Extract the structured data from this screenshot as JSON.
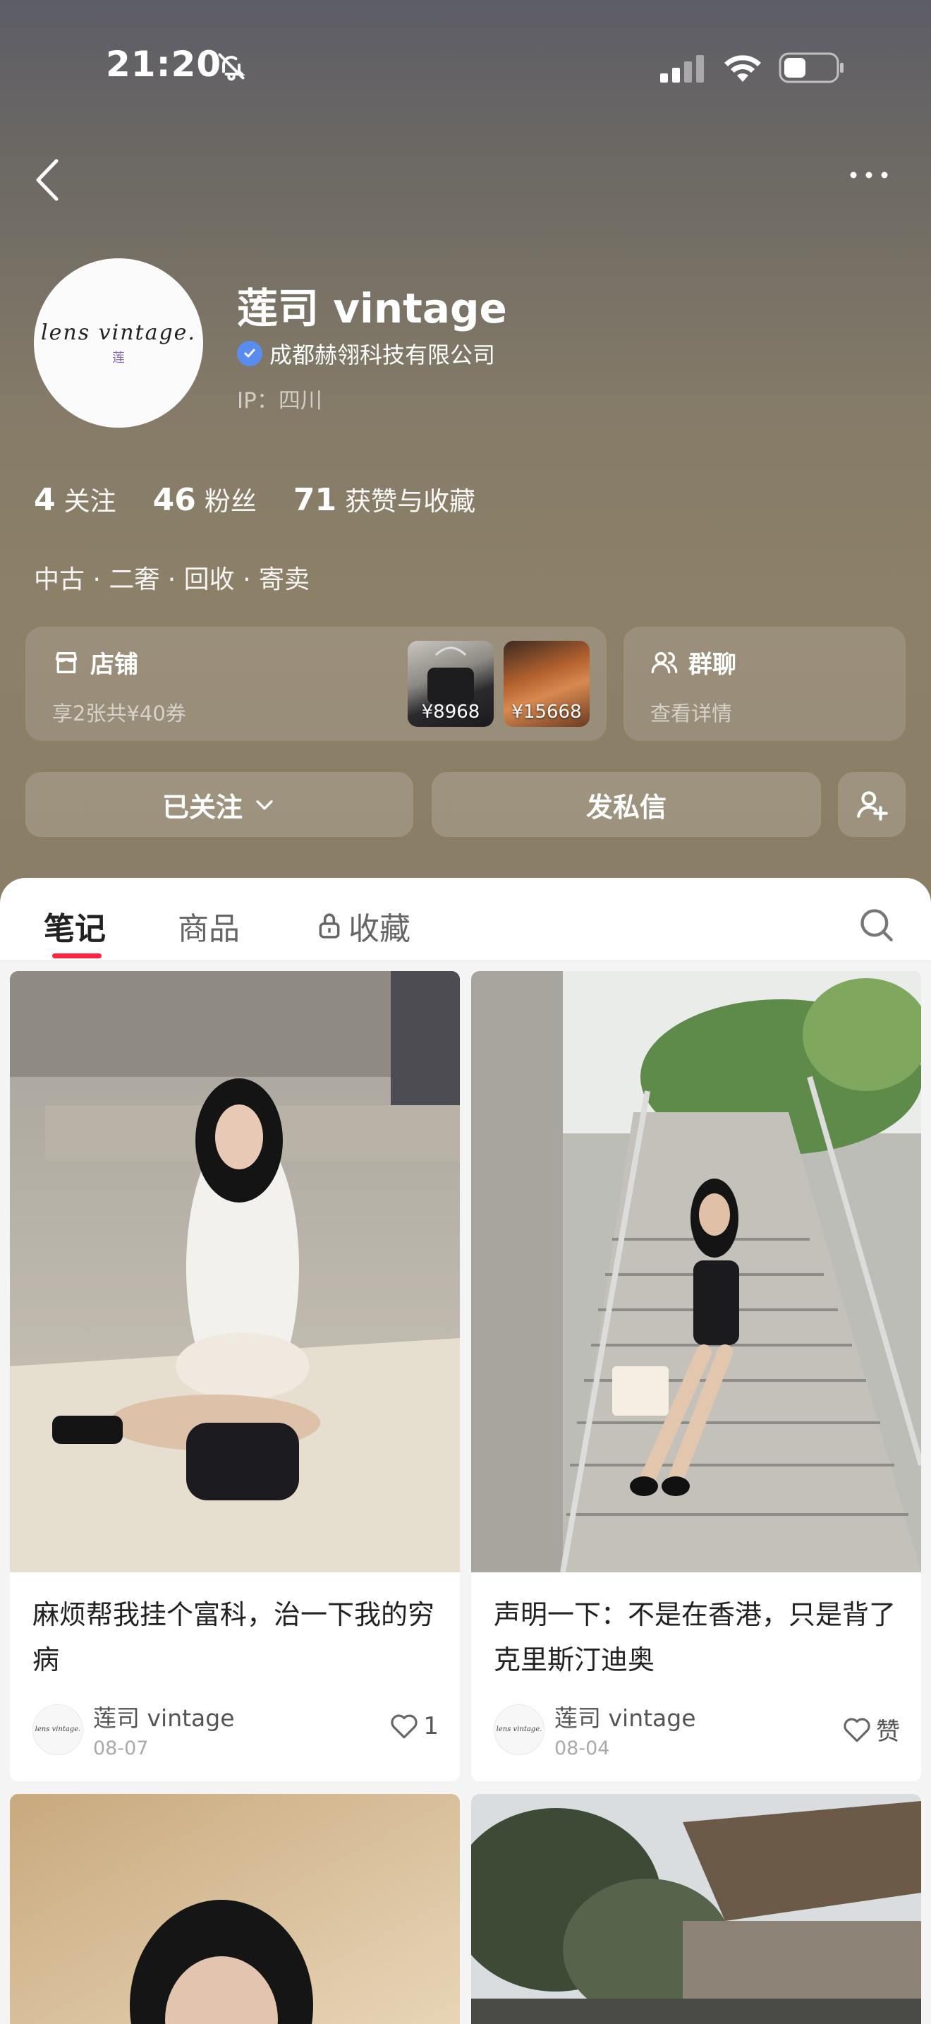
{
  "status_bar": {
    "time": "21:20",
    "icons": [
      "bell-off-icon",
      "cellular-signal-icon",
      "wifi-icon",
      "battery-icon"
    ]
  },
  "nav": {
    "back_icon": "chevron-left-icon",
    "more_icon": "more-horizontal-icon"
  },
  "profile": {
    "avatar_text": "lens vintage.",
    "avatar_mark": "莲",
    "nickname": "莲司 vintage",
    "verified_company": "成都赫翎科技有限公司",
    "ip_location": "IP：四川",
    "stats": [
      {
        "value": "4",
        "label": "关注"
      },
      {
        "value": "46",
        "label": "粉丝"
      },
      {
        "value": "71",
        "label": "获赞与收藏"
      }
    ],
    "bio": "中古 · 二奢 · 回收 · 寄卖"
  },
  "shop": {
    "title": "店铺",
    "subtitle": "享2张共¥40券",
    "products": [
      {
        "price": "¥8968"
      },
      {
        "price": "¥15668"
      }
    ]
  },
  "group_chat": {
    "title": "群聊",
    "subtitle": "查看详情"
  },
  "actions": {
    "follow_label": "已关注",
    "message_label": "发私信"
  },
  "tabs": {
    "notes": "笔记",
    "goods": "商品",
    "favorites": "收藏"
  },
  "notes": [
    {
      "title": "麻烦帮我挂个富科，治一下我的穷病",
      "author": "莲司 vintage",
      "date": "08-07",
      "likes": "1"
    },
    {
      "title": "声明一下：不是在香港，只是背了克里斯汀迪奥",
      "author": "莲司 vintage",
      "date": "08-04",
      "likes": "赞"
    }
  ],
  "colors": {
    "accent": "#ff2442",
    "verified": "#5a8cf0",
    "header_top": "#5d5d66",
    "header_bottom": "#8a7e66"
  }
}
